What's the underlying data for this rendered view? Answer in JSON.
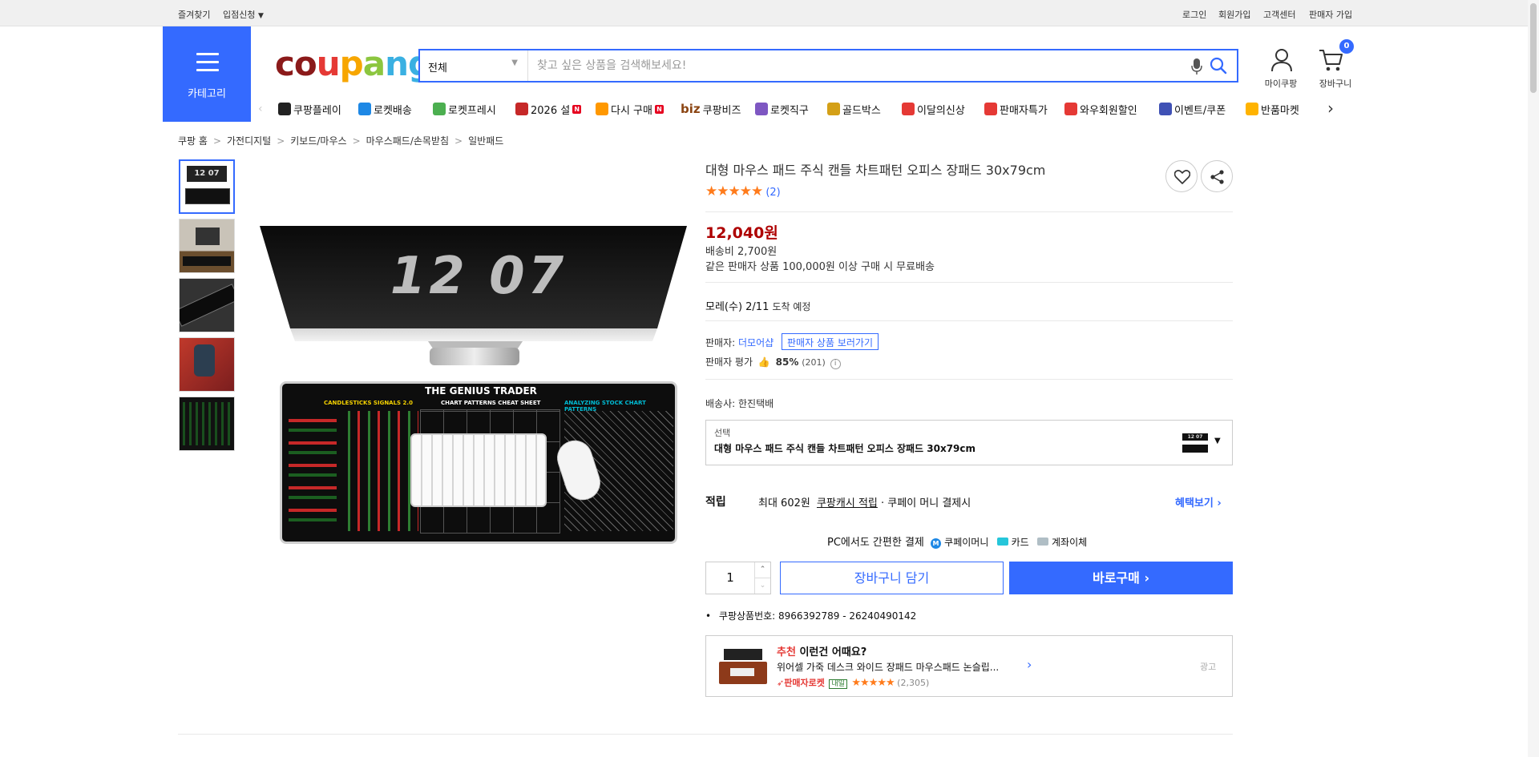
{
  "topbar": {
    "left": [
      "즐겨찾기",
      "입점신청"
    ],
    "right": [
      "로그인",
      "회원가입",
      "고객센터",
      "판매자 가입"
    ]
  },
  "header": {
    "category_label": "카테고리",
    "logo": [
      "c",
      "o",
      "u",
      "p",
      "a",
      "n",
      "g"
    ],
    "search_category": "전체",
    "search_placeholder": "찾고 싶은 상품을 검색해보세요!",
    "mycoupang_label": "마이쿠팡",
    "cart_label": "장바구니",
    "cart_count": "0"
  },
  "nav": [
    {
      "label": "쿠팡플레이",
      "icon": "play-icon",
      "color": "#222"
    },
    {
      "label": "로켓배송",
      "icon": "rocket-icon",
      "color": "#1e88e5"
    },
    {
      "label": "로켓프레시",
      "icon": "fresh-rocket-icon",
      "color": "#4caf50"
    },
    {
      "label": "2026 설",
      "icon": "gift-icon",
      "color": "#c62828",
      "badge": "N"
    },
    {
      "label": "다시 구매",
      "icon": "rebuy-icon",
      "color": "#ff9800",
      "badge": "N"
    },
    {
      "label": "쿠팡비즈",
      "icon": "biz-icon",
      "color": "#8b4513",
      "prefix": "biz"
    },
    {
      "label": "로켓직구",
      "icon": "global-rocket-icon",
      "color": "#7e57c2"
    },
    {
      "label": "골드박스",
      "icon": "goldbox-icon",
      "color": "#d4a017"
    },
    {
      "label": "이달의신상",
      "icon": "new-item-icon",
      "color": "#e53935"
    },
    {
      "label": "판매자특가",
      "icon": "seller-deal-icon",
      "color": "#e53935"
    },
    {
      "label": "와우회원할인",
      "icon": "wow-icon",
      "color": "#e53935"
    },
    {
      "label": "이벤트/쿠폰",
      "icon": "coupon-icon",
      "color": "#3f51b5"
    },
    {
      "label": "반품마켓",
      "icon": "return-market-icon",
      "color": "#ffb300"
    }
  ],
  "breadcrumb": [
    "쿠팡 홈",
    "가전디지털",
    "키보드/마우스",
    "마우스패드/손목받침",
    "일반패드"
  ],
  "product": {
    "title": "대형 마우스 패드 주식 캔들 차트패턴 오피스 장패드 30x79cm",
    "rating": 5,
    "review_count": "(2)",
    "price": "12,040원",
    "shipping_fee": "배송비 2,700원",
    "free_shipping_note": "같은 판매자 상품 100,000원 이상 구매 시 무료배송",
    "delivery_eta": "모레(수) 2/11",
    "delivery_suffix": "도착 예정",
    "seller_label": "판매자:",
    "seller_name": "더모어샵",
    "seller_products_link": "판매자 상품 보러가기",
    "seller_rating_label": "판매자 평가",
    "seller_rating_value": "85%",
    "seller_rating_count": "(201)",
    "carrier_label": "배송사:",
    "carrier_name": "한진택배",
    "option_label": "선택",
    "option_value": "대형 마우스 패드 주식 캔들 차트패턴 오피스 장패드 30x79cm",
    "reward_title": "적립",
    "reward_max": "최대 602원",
    "reward_cash": "쿠팡캐시 적립",
    "reward_note": "· 쿠페이 머니 결제시",
    "reward_link": "혜택보기",
    "pay_title": "PC에서도 간편한 결제",
    "pay_methods": [
      "쿠페이머니",
      "카드",
      "계좌이체"
    ],
    "quantity": "1",
    "cart_button": "장바구니 담기",
    "buy_button": "바로구매",
    "product_no_label": "쿠팡상품번호:",
    "product_no": "8966392789 - 26240490142"
  },
  "hero_image": {
    "clock_text": "12 07",
    "pad_title": "THE GENIUS TRADER",
    "pad_sections": [
      "CANDLESTICKS SIGNALS 2.0",
      "CHART PATTERNS CHEAT SHEET",
      "ANALYZING STOCK CHART PATTERNS"
    ]
  },
  "recommend": {
    "title_highlight": "추천",
    "title_rest": " 이런건 어때요?",
    "item_name": "위어셀 가죽 데스크 와이드 장패드 마우스패드 논슬립...",
    "badge": "판매자로켓",
    "badge_day": "내일",
    "review_count": "(2,305)",
    "ad_label": "광고"
  },
  "colors": {
    "accent": "#346aff",
    "price": "#ae0000",
    "star": "#ff7b1b"
  }
}
